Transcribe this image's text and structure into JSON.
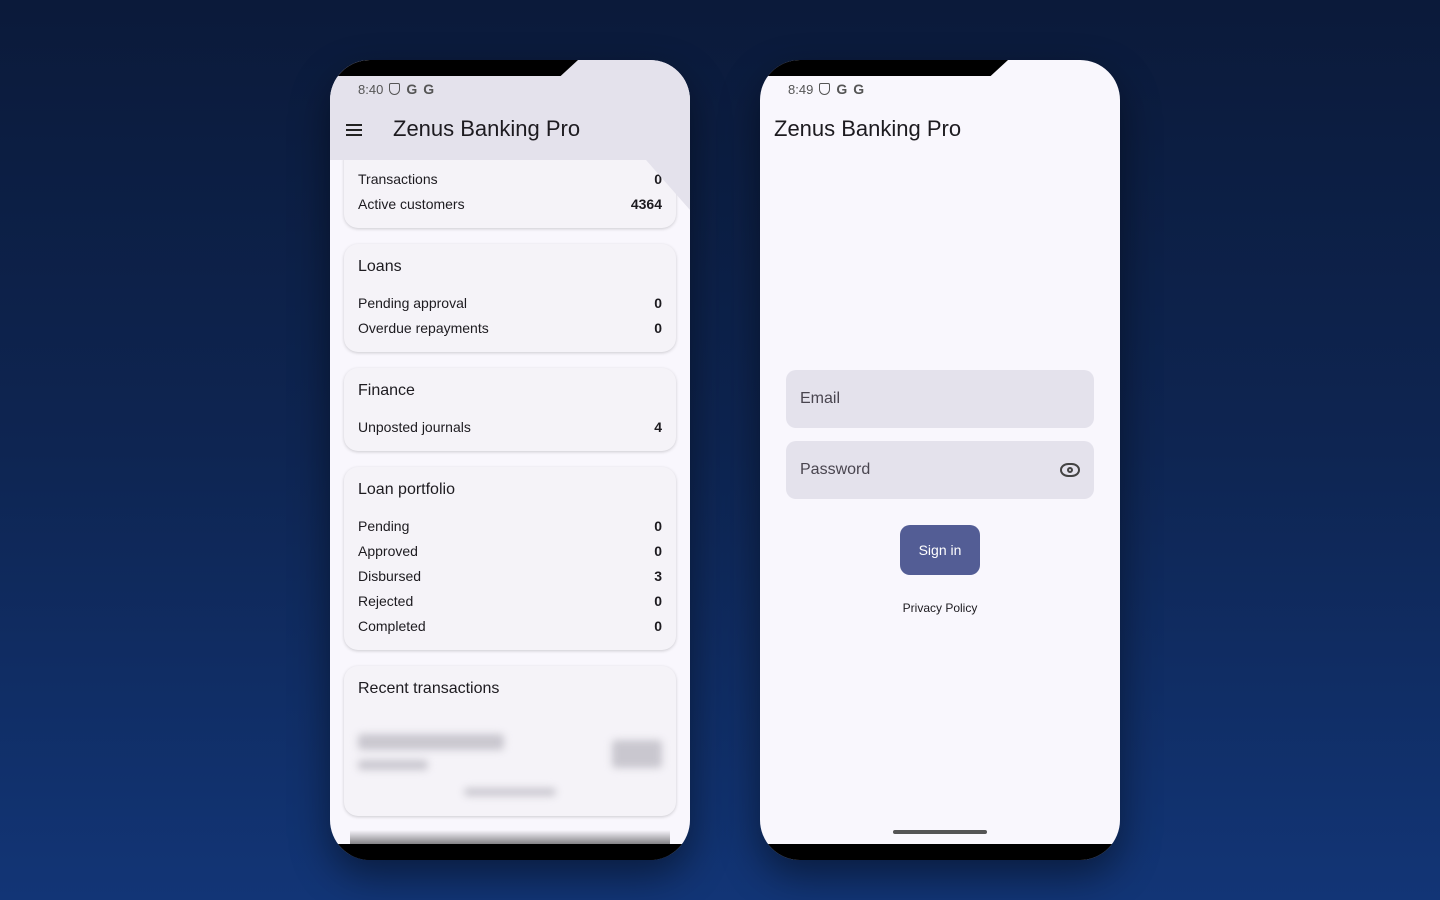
{
  "left_phone": {
    "status_time": "8:40",
    "app_title": "Zenus Banking Pro",
    "summary_card": {
      "rows": [
        {
          "label": "Transactions",
          "value": "0"
        },
        {
          "label": "Active customers",
          "value": "4364"
        }
      ]
    },
    "loans_card": {
      "title": "Loans",
      "rows": [
        {
          "label": "Pending approval",
          "value": "0"
        },
        {
          "label": "Overdue repayments",
          "value": "0"
        }
      ]
    },
    "finance_card": {
      "title": "Finance",
      "rows": [
        {
          "label": "Unposted journals",
          "value": "4"
        }
      ]
    },
    "portfolio_card": {
      "title": "Loan portfolio",
      "rows": [
        {
          "label": "Pending",
          "value": "0"
        },
        {
          "label": "Approved",
          "value": "0"
        },
        {
          "label": "Disbursed",
          "value": "3"
        },
        {
          "label": "Rejected",
          "value": "0"
        },
        {
          "label": "Completed",
          "value": "0"
        }
      ]
    },
    "recent_card": {
      "title": "Recent transactions"
    }
  },
  "right_phone": {
    "status_time": "8:49",
    "app_title": "Zenus Banking Pro",
    "email_placeholder": "Email",
    "password_placeholder": "Password",
    "signin_label": "Sign in",
    "privacy_label": "Privacy Policy"
  },
  "status_icons": [
    "shield-icon",
    "google-icon",
    "google-icon"
  ],
  "colors": {
    "primary_button": "#535d95",
    "appbar": "#e4e2ec",
    "background_top": "#0b1a3a",
    "background_bottom": "#123576"
  }
}
